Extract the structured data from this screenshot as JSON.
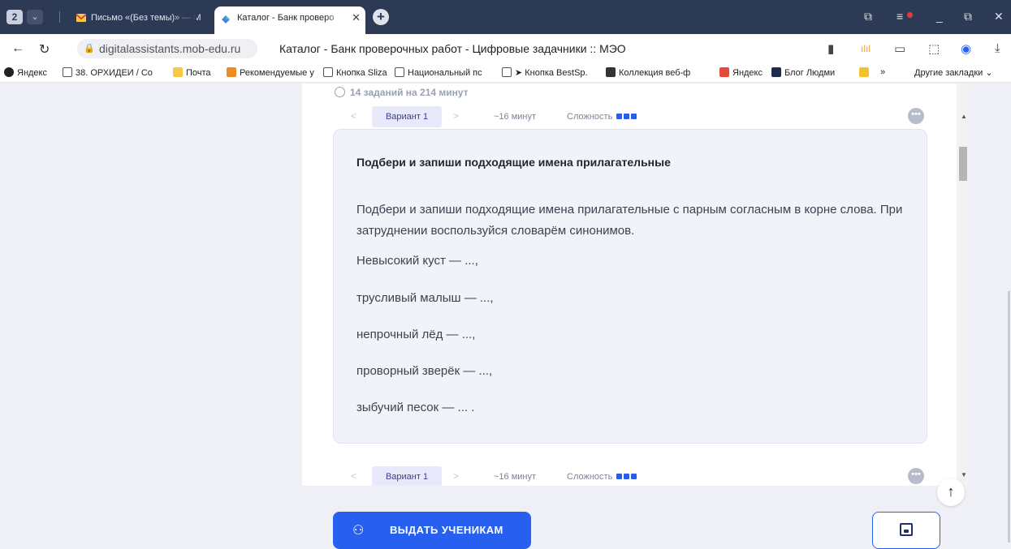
{
  "browser": {
    "tab_count": "2",
    "tabs": [
      {
        "title": "Письмо «(Без темы)» — M",
        "icon": "mail-icon"
      },
      {
        "title": "Каталог - Банк проверо",
        "icon": "catalog-icon"
      }
    ],
    "url_domain": "digitalassistants.mob-edu.ru",
    "page_title": "Каталог - Банк проверочных работ - Цифровые задачники :: МЭО",
    "bookmarks": [
      "Яндекс",
      "38. ОРХИДЕИ / Со",
      "Почта",
      "Рекомендуемые у",
      "Кнопка Sliza",
      "Национальный пс",
      "➤ Кнопка BestSp.",
      "Коллекция веб-ф",
      "Яндекс",
      "Блог Людми",
      "»"
    ],
    "other_bookmarks": "Другие закладки"
  },
  "summary": "14 заданий на 214 минут",
  "task": {
    "variant": "Вариант 1",
    "time": "~16 минут",
    "difficulty_label": "Сложность",
    "difficulty_level": 3,
    "title": "Подбери и запиши подходящие имена прилагательные",
    "text": "Подбери и запиши подходящие имена прилагательные с парным согласным в корне слова. При затруднении воспользуйся словарём синонимов.",
    "lines": [
      "Невысокий куст — ...,",
      "трусливый малыш — ...,",
      "непрочный лёд — ...,",
      "проворный зверёк — ...,",
      "зыбучий песок — ... ."
    ]
  },
  "next_task": {
    "variant": "Вариант 1",
    "time": "~16 минут",
    "difficulty_label": "Сложность"
  },
  "actions": {
    "assign_label": "ВЫДАТЬ УЧЕНИКАМ"
  },
  "colors": {
    "accent": "#2760f1",
    "chrome": "#2d3a55"
  }
}
